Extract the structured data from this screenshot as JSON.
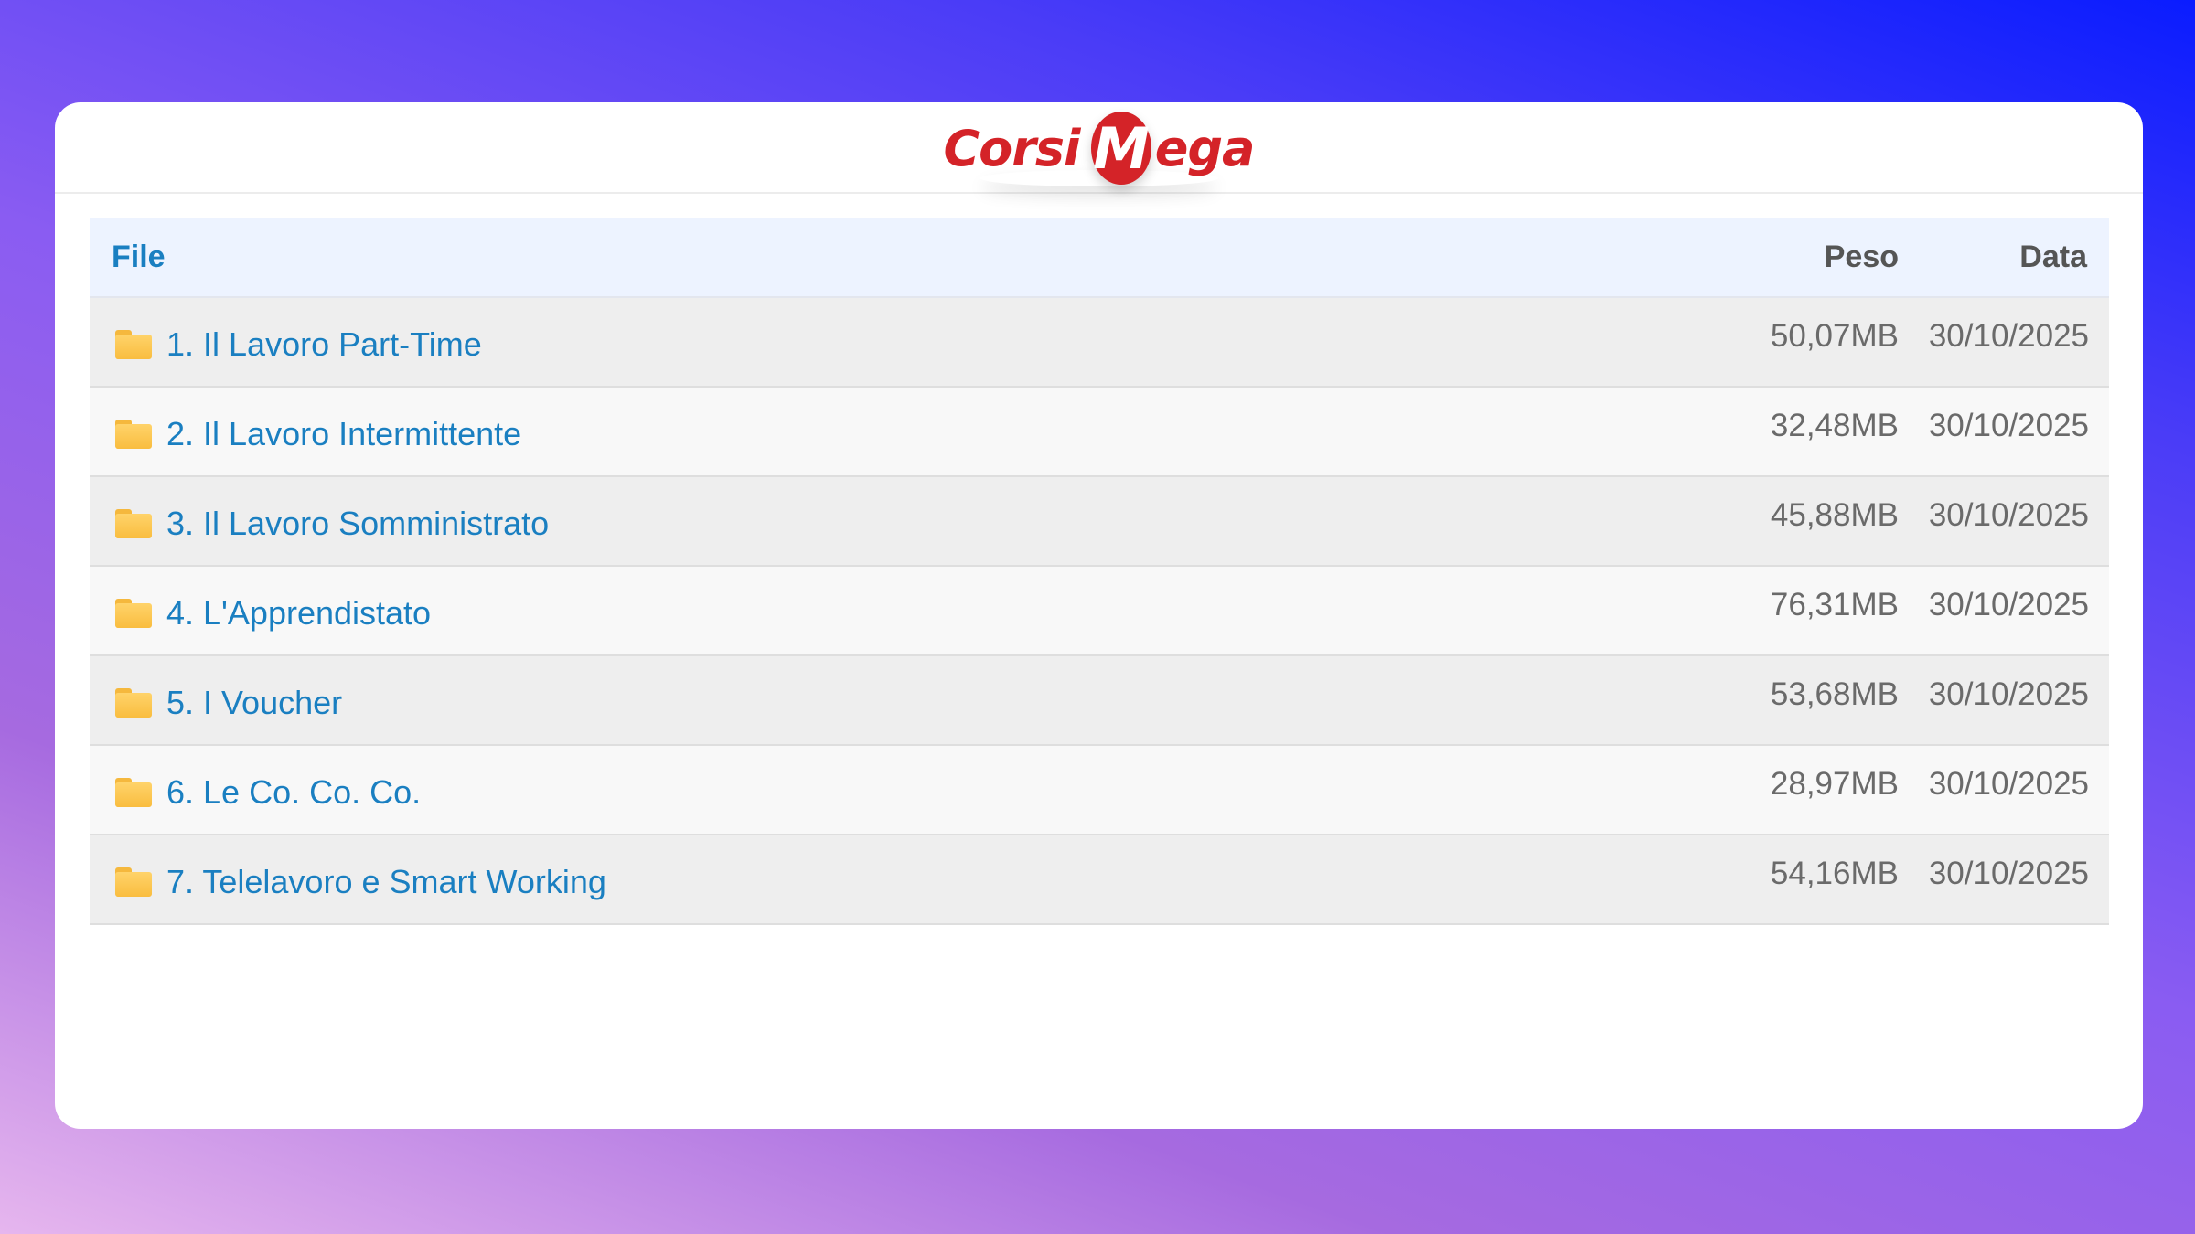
{
  "brand": {
    "logo_part1": "Corsi",
    "logo_m": "M",
    "logo_part2": "ega",
    "color": "#d42328"
  },
  "table": {
    "headers": {
      "file": "File",
      "size": "Peso",
      "date": "Data"
    },
    "rows": [
      {
        "icon": "folder-icon",
        "name": "1. Il Lavoro Part-Time",
        "size": "50,07MB",
        "date": "30/10/2025"
      },
      {
        "icon": "folder-icon",
        "name": "2. Il Lavoro Intermittente",
        "size": "32,48MB",
        "date": "30/10/2025"
      },
      {
        "icon": "folder-icon",
        "name": "3. Il Lavoro Somministrato",
        "size": "45,88MB",
        "date": "30/10/2025"
      },
      {
        "icon": "folder-icon",
        "name": "4. L'Apprendistato",
        "size": "76,31MB",
        "date": "30/10/2025"
      },
      {
        "icon": "folder-icon",
        "name": "5. I Voucher",
        "size": "53,68MB",
        "date": "30/10/2025"
      },
      {
        "icon": "folder-icon",
        "name": "6. Le Co. Co. Co.",
        "size": "28,97MB",
        "date": "30/10/2025"
      },
      {
        "icon": "folder-icon",
        "name": "7. Telelavoro e Smart Working",
        "size": "54,16MB",
        "date": "30/10/2025"
      }
    ]
  },
  "colors": {
    "link": "#1a7fc1",
    "header_bg": "#edf3ff",
    "folder": "#f9bd3f"
  }
}
